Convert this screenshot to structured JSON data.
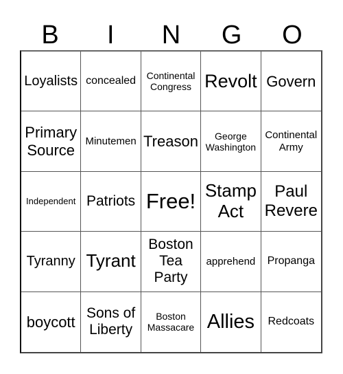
{
  "header": {
    "letters": [
      "B",
      "I",
      "N",
      "G",
      "O"
    ]
  },
  "grid": {
    "rows": [
      [
        "Loyalists",
        "concealed",
        "Continental Congress",
        "Revolt",
        "Govern"
      ],
      [
        "Primary Source",
        "Minutemen",
        "Treason",
        "George Washington",
        "Continental Army"
      ],
      [
        "Independent",
        "Patriots",
        "Free!",
        "Stamp Act",
        "Paul Revere"
      ],
      [
        "Tyranny",
        "Tyrant",
        "Boston Tea Party",
        "apprehend",
        "Propanga"
      ],
      [
        "boycott",
        "Sons of Liberty",
        "Boston Massacare",
        "Allies",
        "Redcoats"
      ]
    ],
    "free_space": "Free!"
  }
}
